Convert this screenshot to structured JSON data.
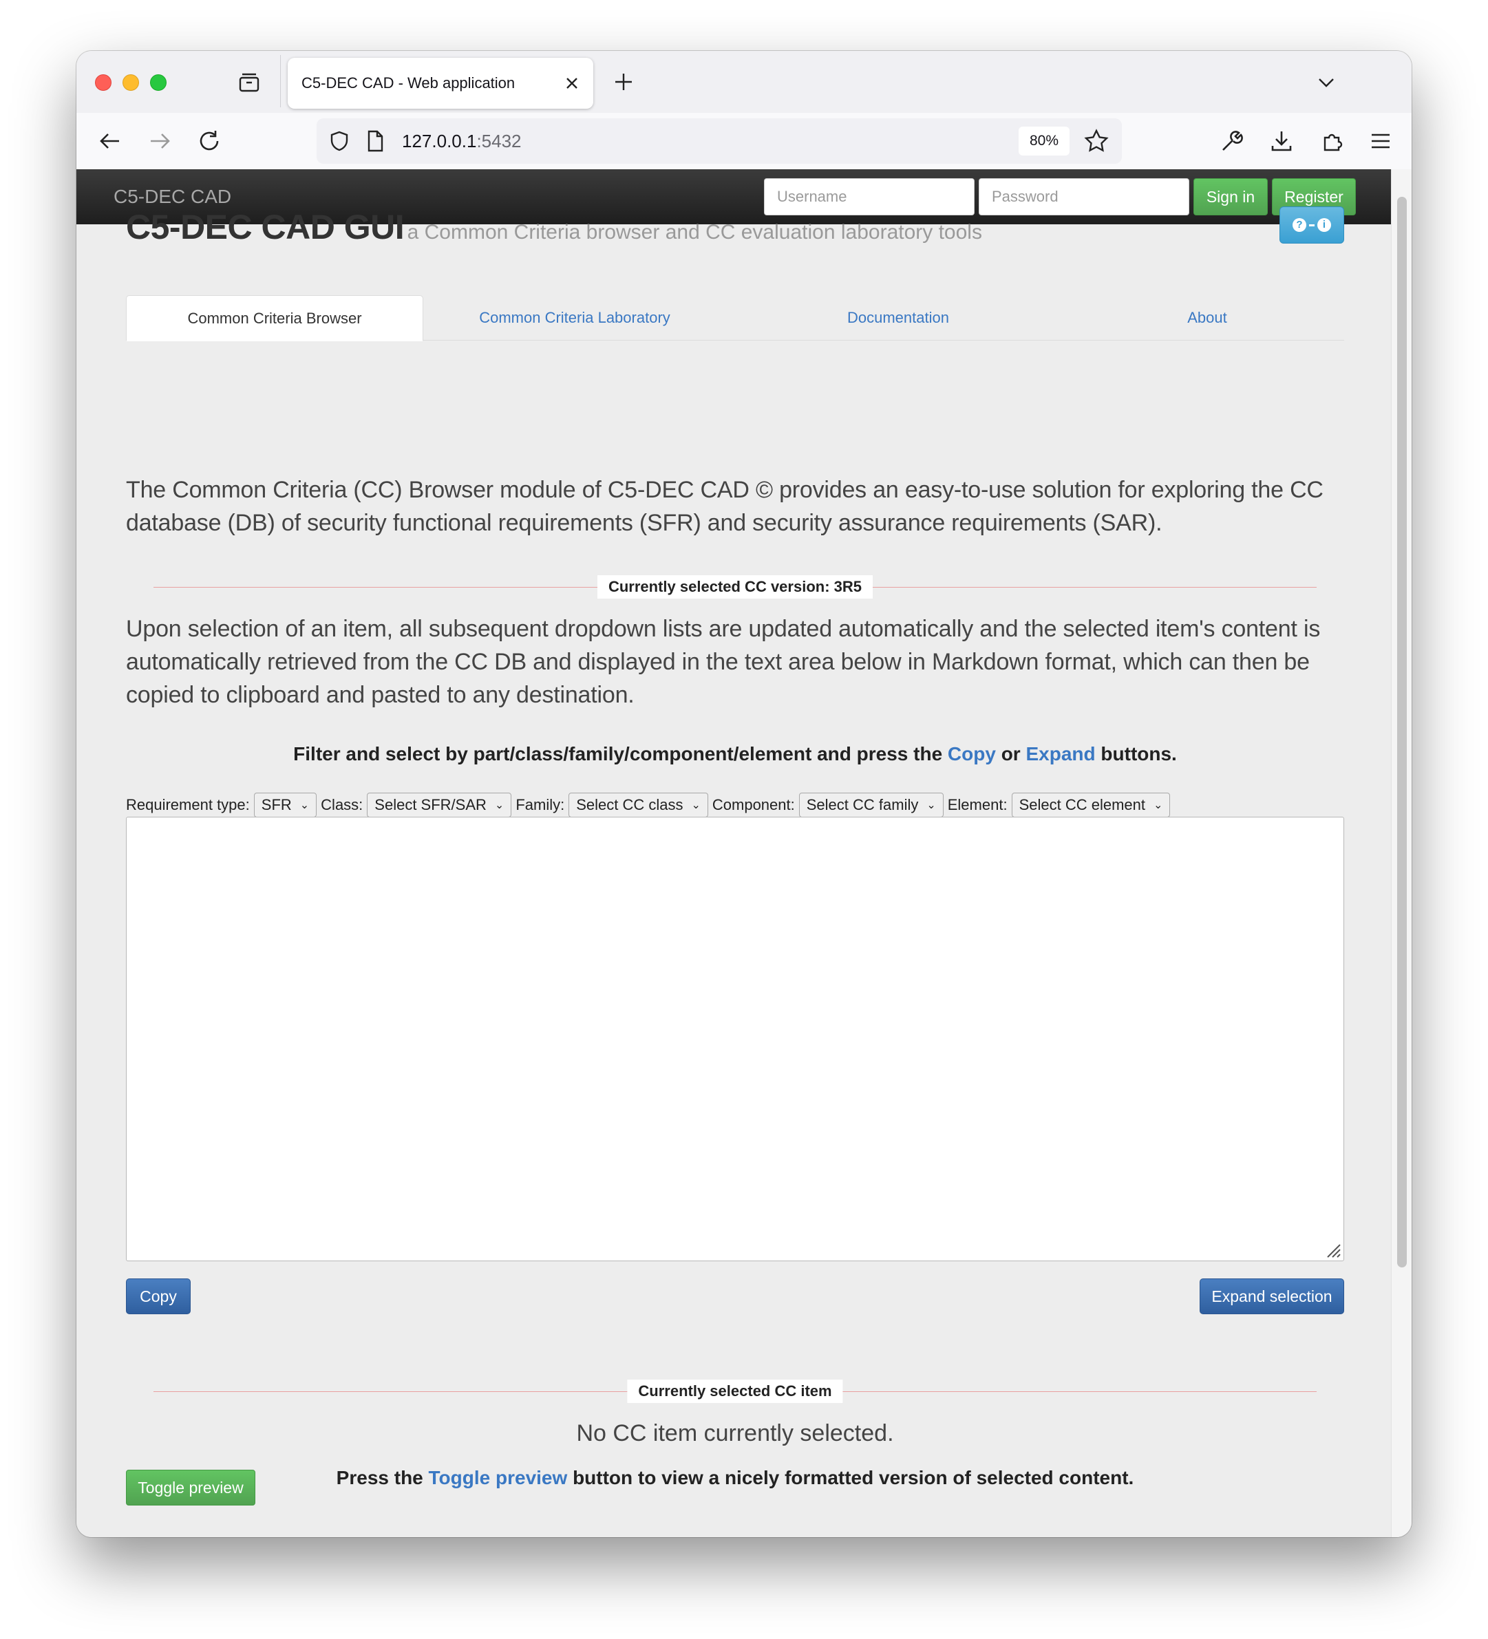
{
  "browser": {
    "tab_title": "C5-DEC CAD - Web application",
    "url_host": "127.0.0.1",
    "url_port": ":5432",
    "zoom": "80%"
  },
  "app": {
    "brand": "C5-DEC CAD",
    "username_placeholder": "Username",
    "password_placeholder": "Password",
    "sign_in_label": "Sign in",
    "register_label": "Register",
    "title": "C5-DEC CAD GUI",
    "subtitle": "a Common Criteria browser and CC evaluation laboratory tools"
  },
  "tabs": [
    {
      "label": "Common Criteria Browser",
      "active": true
    },
    {
      "label": "Common Criteria Laboratory",
      "active": false
    },
    {
      "label": "Documentation",
      "active": false
    },
    {
      "label": "About",
      "active": false
    }
  ],
  "intro": "The Common Criteria (CC) Browser module of C5-DEC CAD © provides an easy-to-use solution for exploring the CC database (DB) of security functional requirements (SFR) and security assurance requirements (SAR).",
  "version_label": "Currently selected CC version: 3R5",
  "description": "Upon selection of an item, all subsequent dropdown lists are updated automatically and the selected item's content is automatically retrieved from the CC DB and displayed in the text area below in Markdown format, which can then be copied to clipboard and pasted to any destination.",
  "filter_instruction": {
    "before": "Filter and select by part/class/family/component/element and press the",
    "copy": "Copy",
    "or": "or",
    "expand": "Expand",
    "after": "buttons."
  },
  "filters": {
    "requirement_type": {
      "label": "Requirement type:",
      "value": "SFR"
    },
    "class": {
      "label": "Class:",
      "value": "Select SFR/SAR"
    },
    "family": {
      "label": "Family:",
      "value": "Select CC class"
    },
    "component": {
      "label": "Component:",
      "value": "Select CC family"
    },
    "element": {
      "label": "Element:",
      "value": "Select CC element"
    }
  },
  "content_text": "",
  "buttons": {
    "copy": "Copy",
    "expand_selection": "Expand selection",
    "toggle_preview": "Toggle preview"
  },
  "selected_item_label": "Currently selected CC item",
  "no_item_text": "No CC item currently selected.",
  "preview_instruction": {
    "before": "Press the",
    "link": "Toggle preview",
    "after": "button to view a nicely formatted version of selected content."
  },
  "colors": {
    "link": "#3a78c3",
    "success": "#51a351",
    "primary": "#2f5f9f",
    "info": "#3aa0d3",
    "divider": "#e8a0a0"
  }
}
